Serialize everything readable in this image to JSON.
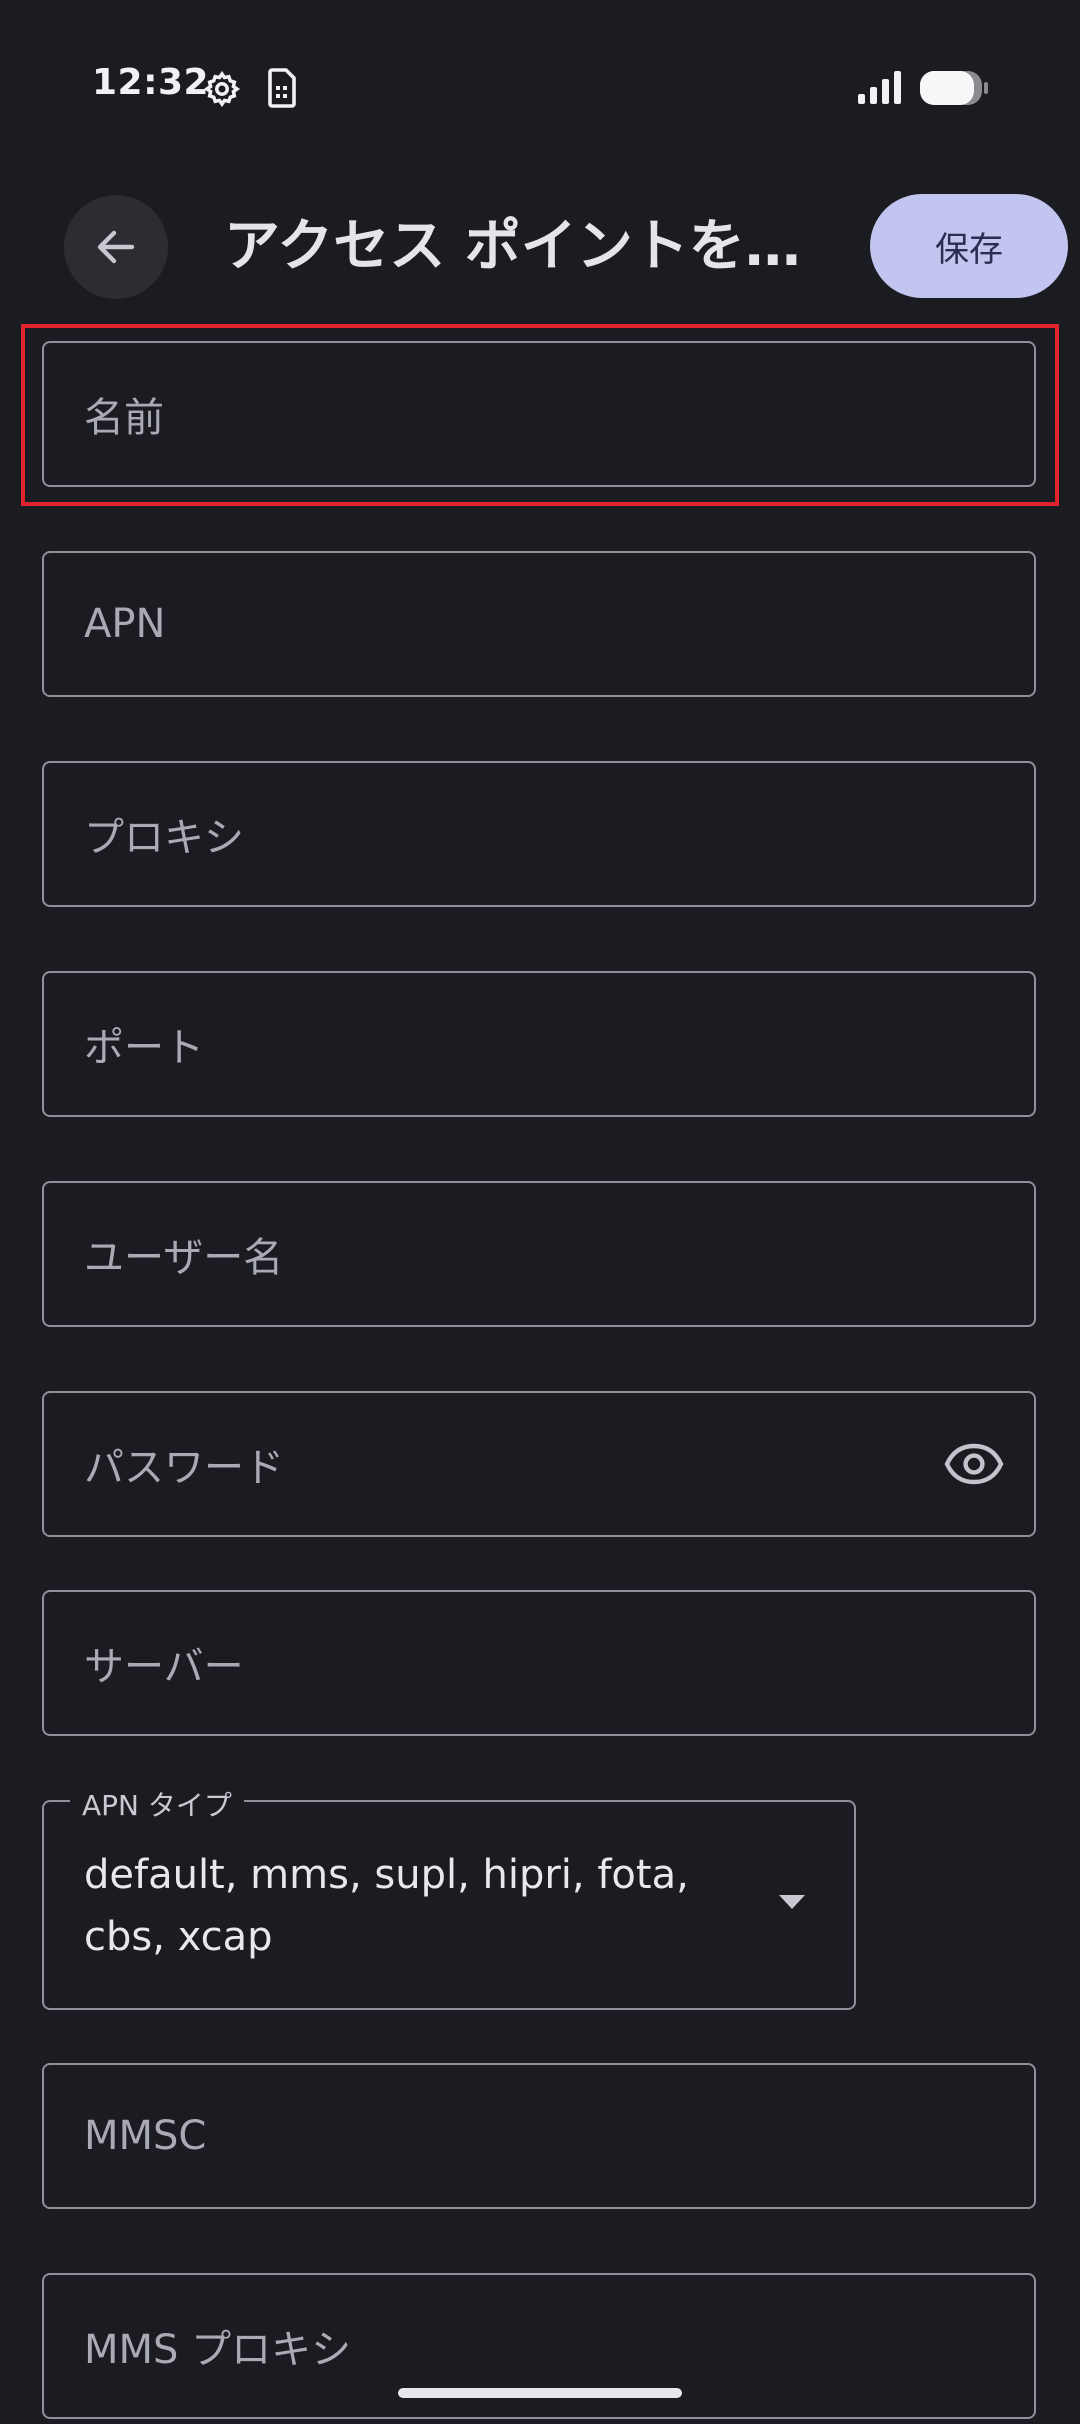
{
  "status_bar": {
    "time": "12:32",
    "icons": [
      "gear-icon",
      "sim-card-icon",
      "signal-icon",
      "battery-icon"
    ]
  },
  "app_bar": {
    "back_icon": "arrow-left-icon",
    "title": "アクセス ポイントを…",
    "save_label": "保存"
  },
  "fields": {
    "name": "名前",
    "apn": "APN",
    "proxy": "プロキシ",
    "port": "ポート",
    "username": "ユーザー名",
    "password": "パスワード",
    "server": "サーバー",
    "mmsc": "MMSC",
    "mms_proxy": "MMS プロキシ"
  },
  "apn_type": {
    "label": "APN タイプ",
    "value": "default, mms, supl, hipri, fota, cbs, xcap"
  },
  "colors": {
    "background": "#1b1c21",
    "save_button": "#c2c5f0",
    "highlight": "#e0232e",
    "field_border": "#8f9099"
  }
}
